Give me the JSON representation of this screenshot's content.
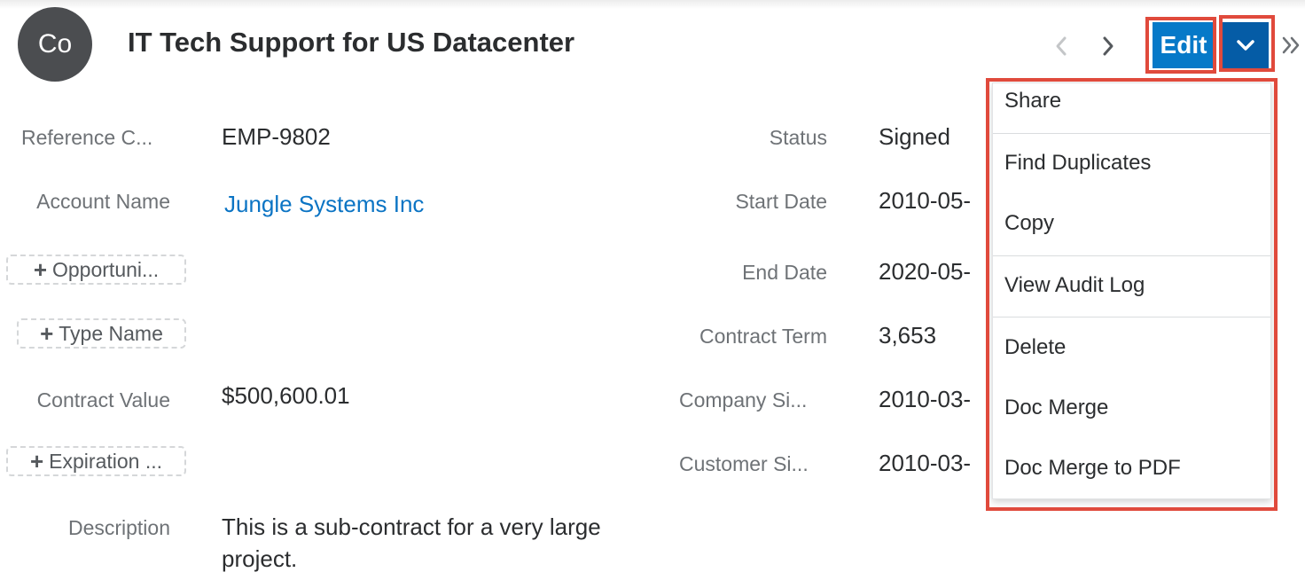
{
  "record": {
    "avatar_initials": "Co",
    "title": "IT Tech Support for US Datacenter"
  },
  "header": {
    "prev_icon": "chevron-left-icon",
    "next_icon": "chevron-right-icon",
    "edit_label": "Edit",
    "actions_icon": "chevron-down-icon",
    "more_icon": "double-chevron-right-icon"
  },
  "fields_left": [
    {
      "label": "Reference C...",
      "value": "EMP-9802"
    },
    {
      "label": "Account Name",
      "value": "Jungle Systems Inc"
    },
    {
      "label": "Contract Value",
      "value": "$500,600.01"
    },
    {
      "label": "Description",
      "value": "This is a sub-contract for a very large project."
    }
  ],
  "add_fields": [
    {
      "label": "Opportuni..."
    },
    {
      "label": "Type Name"
    },
    {
      "label": "Expiration ..."
    }
  ],
  "fields_right": [
    {
      "label": "Status",
      "value": "Signed"
    },
    {
      "label": "Start Date",
      "value": "2010-05-"
    },
    {
      "label": "End Date",
      "value": "2020-05-"
    },
    {
      "label": "Contract Term",
      "value": "3,653"
    },
    {
      "label": "Company Si...",
      "value": "2010-03-"
    },
    {
      "label": "Customer Si...",
      "value": "2010-03-"
    }
  ],
  "actions_menu": {
    "items": [
      {
        "label": "Share"
      },
      {
        "label": "Find Duplicates"
      },
      {
        "label": "Copy"
      },
      {
        "label": "View Audit Log"
      },
      {
        "label": "Delete"
      },
      {
        "label": "Doc Merge"
      },
      {
        "label": "Doc Merge to PDF"
      }
    ]
  },
  "colors": {
    "primary": "#0679c8",
    "primary_dark": "#055ca6",
    "highlight": "#e04a3c",
    "link": "#0b74c4"
  }
}
